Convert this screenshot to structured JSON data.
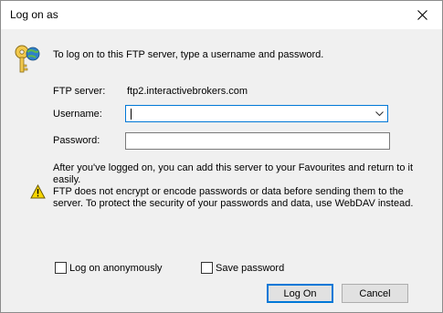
{
  "window": {
    "title": "Log on as"
  },
  "icons": {
    "close": "close-icon",
    "key": "key-icon",
    "warning": "warning-icon",
    "dropdown": "chevron-down-icon"
  },
  "colors": {
    "focus_border": "#0078d7",
    "window_bg": "#f0f0f0",
    "button_bg": "#e1e1e1"
  },
  "dialog": {
    "intro": "To log on to this FTP server, type a username and password.",
    "server_label": "FTP server:",
    "server_value": "ftp2.interactivebrokers.com",
    "username_label": "Username:",
    "username_value": "",
    "password_label": "Password:",
    "password_value": "",
    "info_text": "After you've logged on, you can add this server to your Favourites and return to it easily.",
    "warning_text": "FTP does not encrypt or encode passwords or data before sending them to the server. To protect the security of your passwords and data, use WebDAV instead.",
    "anonymous_label": "Log on anonymously",
    "anonymous_checked": false,
    "save_password_label": "Save password",
    "save_password_checked": false,
    "logon_button": "Log On",
    "cancel_button": "Cancel"
  }
}
